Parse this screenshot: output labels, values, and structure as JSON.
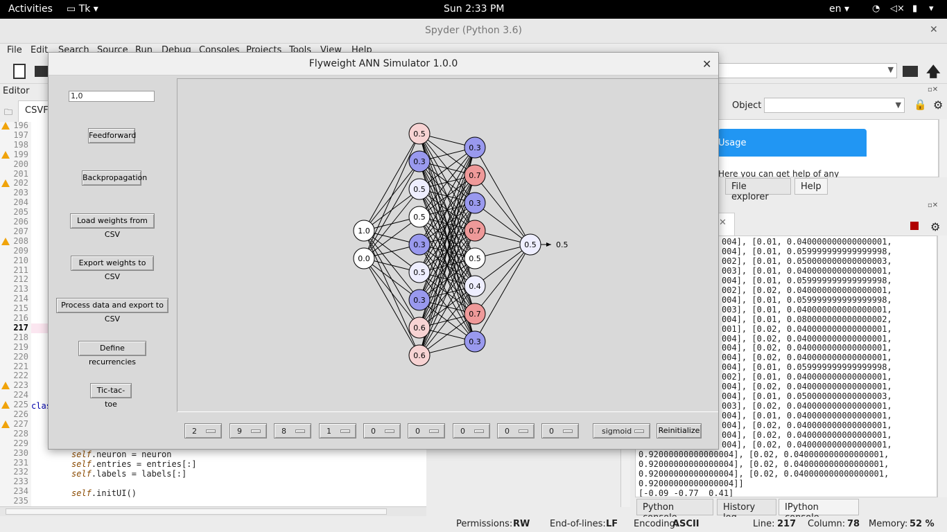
{
  "topbar": {
    "activities": "Activities",
    "app": "Tk",
    "clock": "Sun  2:33 PM",
    "lang": "en"
  },
  "spyder": {
    "title": "Spyder (Python 3.6)",
    "menu": [
      "File",
      "Edit",
      "Search",
      "Source",
      "Run",
      "Debug",
      "Consoles",
      "Projects",
      "Tools",
      "View",
      "Help"
    ],
    "editor_label": "Editor",
    "editor_tab": "CSVF",
    "object_label": "Object",
    "usage_title": "Usage",
    "usage_text": "Here you can get help of any object",
    "pane_tabs": [
      "File explorer",
      "Help"
    ],
    "console_tabs": [
      "Python console",
      "History log",
      "IPython console"
    ],
    "line_numbers": [
      "196",
      "197",
      "198",
      "199",
      "200",
      "201",
      "202",
      "203",
      "204",
      "205",
      "206",
      "207",
      "208",
      "209",
      "210",
      "211",
      "212",
      "213",
      "214",
      "215",
      "216",
      "217",
      "218",
      "219",
      "220",
      "221",
      "222",
      "223",
      "224",
      "225",
      "226",
      "227",
      "228",
      "229",
      "230",
      "231",
      "232",
      "233",
      "234",
      "235"
    ],
    "current_line": "217",
    "code_class": "clas",
    "code_lines": [
      {
        "self": "self",
        "rest": ".neuron = neuron"
      },
      {
        "self": "self",
        "rest": ".entries = entries[:]"
      },
      {
        "self": "self",
        "rest": ".labels = labels[:]"
      },
      {
        "self": "",
        "rest": ""
      },
      {
        "self": "self",
        "rest": ".initUI()"
      }
    ],
    "console_lines": [
      "004], [0.01, 0.040000000000000001,",
      "004], [0.01, 0.059999999999999998,",
      "002], [0.01, 0.050000000000000003,",
      "003], [0.01, 0.040000000000000001,",
      "004], [0.01, 0.059999999999999998,",
      "002], [0.02, 0.040000000000000001,",
      "004], [0.01, 0.059999999999999998,",
      "003], [0.01, 0.040000000000000001,",
      "004], [0.01, 0.080000000000000002,",
      "001], [0.02, 0.040000000000000001,",
      "004], [0.02, 0.040000000000000001,",
      "004], [0.02, 0.040000000000000001,",
      "004], [0.02, 0.040000000000000001,",
      "004], [0.01, 0.059999999999999998,",
      "002], [0.01, 0.040000000000000001,",
      "004], [0.02, 0.040000000000000001,",
      "004], [0.01, 0.050000000000000003,",
      "003], [0.02, 0.040000000000000001,",
      "004], [0.01, 0.040000000000000001,",
      "004], [0.02, 0.040000000000000001,",
      "004], [0.02, 0.040000000000000001,",
      "004], [0.02, 0.040000000000000001,",
      "0.92000000000000004], [0.02, 0.040000000000000001,",
      "0.92000000000000004], [0.02, 0.040000000000000001,",
      "0.92000000000000004], [0.02, 0.040000000000000001,",
      "0.92000000000000004]]",
      "[-0.09 -0.77  0.41]"
    ],
    "status": {
      "perm_label": "Permissions:",
      "perm": "RW",
      "eol_label": "End-of-lines:",
      "eol": "LF",
      "enc_label": "Encoding:",
      "enc": "ASCII",
      "line_label": "Line:",
      "line": "217",
      "col_label": "Column:",
      "col": "78",
      "mem_label": "Memory:",
      "mem": "52 %"
    }
  },
  "dialog": {
    "title": "Flyweight ANN Simulator 1.0.0",
    "entry_value": "1,0",
    "buttons": [
      "Feedforward",
      "Backpropagation",
      "Load weights from CSV",
      "Export weights to CSV",
      "Process data and export to CSV",
      "Define recurrencies",
      "Tic-tac-toe"
    ],
    "layer_sizes": [
      "2",
      "9",
      "8",
      "1",
      "0",
      "0",
      "0",
      "0",
      "0"
    ],
    "activation": "sigmoid",
    "reinit_label": "Reinitialize",
    "network": {
      "input": [
        "1.0",
        "0.0"
      ],
      "hidden1": [
        "0.5",
        "0.3",
        "0.5",
        "0.5",
        "0.3",
        "0.5",
        "0.3",
        "0.6",
        "0.6"
      ],
      "hidden2": [
        "0.3",
        "0.7",
        "0.3",
        "0.7",
        "0.5",
        "0.4",
        "0.7",
        "0.3"
      ],
      "output": [
        "0.5"
      ],
      "output_label": "0.5"
    },
    "colors": {
      "blue": "#9999ee",
      "red": "#ee9999",
      "light_red": "#f7d3d3",
      "white": "#ffffff",
      "light_blue": "#eeeeff"
    }
  }
}
